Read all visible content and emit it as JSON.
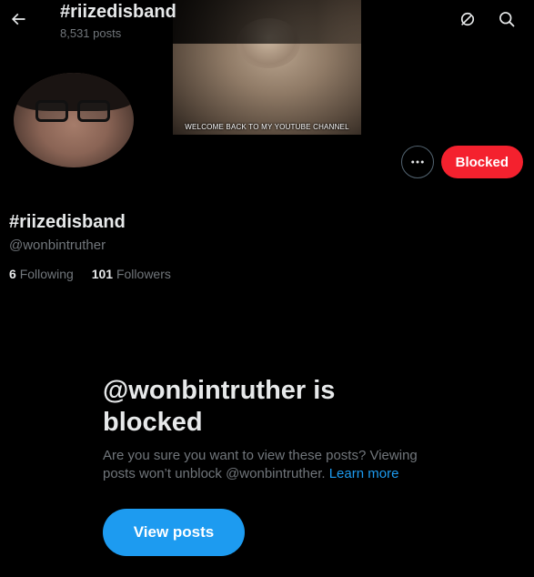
{
  "header": {
    "title": "#riizedisband",
    "posts_count": "8,531 posts"
  },
  "banner": {
    "caption": "WELCOME BACK TO MY YOUTUBE CHANNEL"
  },
  "profile": {
    "display_name": "#riizedisband",
    "handle": "@wonbintruther",
    "following_count": "6",
    "following_label": "Following",
    "followers_count": "101",
    "followers_label": "Followers"
  },
  "actions": {
    "blocked_label": "Blocked"
  },
  "blocked_notice": {
    "title": "@wonbintruther is blocked",
    "body": "Are you sure you want to view these posts? Viewing posts won’t unblock @wonbintruther.",
    "learn_more": "Learn more",
    "view_posts_label": "View posts"
  },
  "colors": {
    "background": "#000000",
    "blocked_red": "#f4212e",
    "accent_blue": "#1d9bf0",
    "muted_text": "#71767b"
  },
  "icons": [
    "back-arrow-icon",
    "grok-icon",
    "search-icon",
    "more-icon"
  ]
}
